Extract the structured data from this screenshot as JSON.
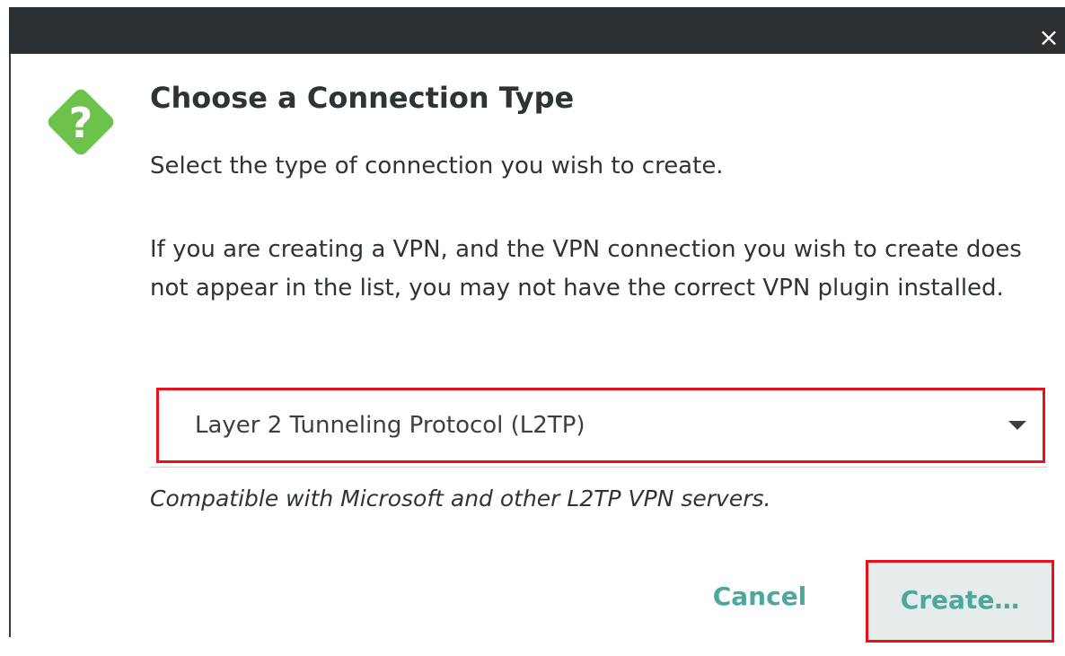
{
  "titlebar": {
    "close_glyph": "×",
    "close_icon": "close-icon"
  },
  "dialog": {
    "icon": "question-icon",
    "icon_color": "#6cc24a",
    "title": "Choose a Connection Type",
    "description": "Select the type of connection you wish to create.",
    "vpn_note": "If you are creating a VPN, and the VPN connection you wish to create does not appear in the list, you may not have the correct VPN plugin installed.",
    "connection_type": {
      "selected": "Layer 2 Tunneling Protocol (L2TP)",
      "arrow_icon": "dropdown-arrow-icon"
    },
    "hint": "Compatible with Microsoft and other L2TP VPN servers.",
    "buttons": {
      "cancel": "Cancel",
      "create": "Create…"
    }
  },
  "colors": {
    "titlebar": "#2d3033",
    "accent_text": "#4aa89c",
    "highlight_border": "#e8101c"
  }
}
